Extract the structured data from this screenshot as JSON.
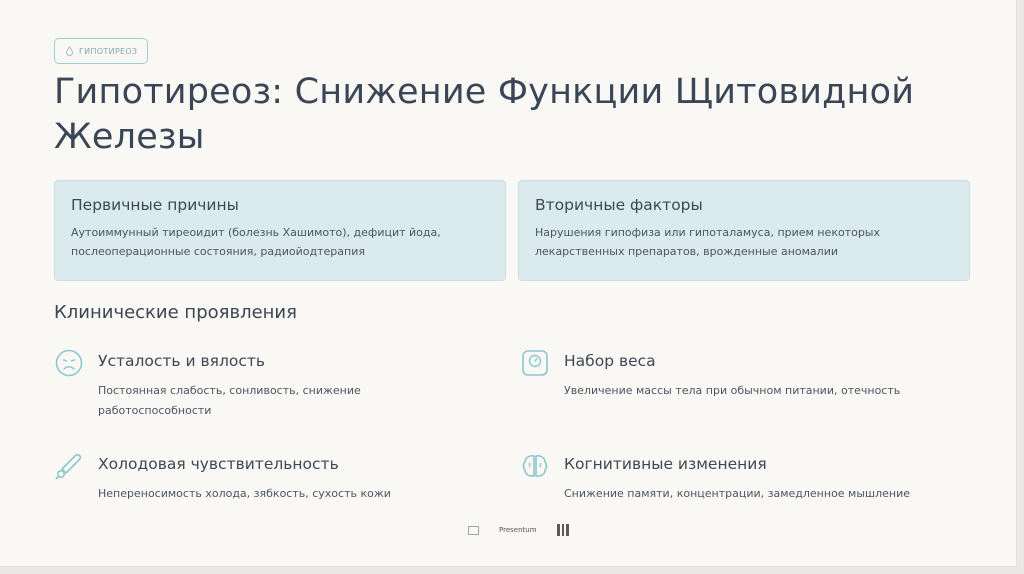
{
  "badge": {
    "label": "ГИПОТИРЕОЗ",
    "icon": "drop-icon"
  },
  "title": "Гипотиреоз: Снижение Функции Щитовидной Железы",
  "cards": [
    {
      "title": "Первичные причины",
      "text": "Аутоиммунный тиреоидит (болезнь Хашимото), дефицит йода, послеоперационные состояния, радиойодтерапия"
    },
    {
      "title": "Вторичные факторы",
      "text": "Нарушения гипофиза или гипоталамуса, прием некоторых лекарственных препаратов, врожденные аномалии"
    }
  ],
  "section_title": "Клинические проявления",
  "items": [
    {
      "icon": "sad-face-icon",
      "title": "Усталость и вялость",
      "text": "Постоянная слабость, сонливость, снижение работоспособности"
    },
    {
      "icon": "scale-icon",
      "title": "Набор веса",
      "text": "Увеличение массы тела при обычном питании, отечность"
    },
    {
      "icon": "thermometer-icon",
      "title": "Холодовая чувствительность",
      "text": "Непереносимость холода, зябкость, сухость кожи"
    },
    {
      "icon": "brain-icon",
      "title": "Когнитивные изменения",
      "text": "Снижение памяти, концентрации, замедленное мышление"
    }
  ],
  "footer": {
    "label": "Presentum"
  },
  "colors": {
    "accent": "#8cc7d0",
    "card_bg": "#dbeaee",
    "title": "#3a4656",
    "background": "#faf8f5"
  }
}
